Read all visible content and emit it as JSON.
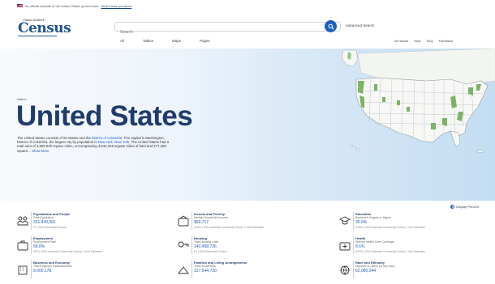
{
  "gov_banner": {
    "text": "An official website of the United States government",
    "link": "Here's how you know"
  },
  "logo": {
    "small": "United States®",
    "big": "Census"
  },
  "search": {
    "placeholder": "Search",
    "advanced": "Advanced Search"
  },
  "tabs": [
    "All",
    "Tables",
    "Maps",
    "Pages"
  ],
  "util_links": [
    "All results",
    "Help",
    "FAQ",
    "Feedback"
  ],
  "hero": {
    "breadcrumb": "Nation",
    "title": "United States",
    "desc_1": "The United States consists of 50 States and the",
    "desc_link_1": "District of Columbia",
    "desc_2": ". The capital is Washington, District of Columbia, the largest city by population is",
    "desc_link_2": "New York, New York",
    "desc_3": ". The United States had a total area of 3,809,525 square miles, encompassing 3,532,316 square miles of land and 277,209 square...",
    "desc_more": "Show More"
  },
  "display_toggle": "Display Percent",
  "cards": [
    {
      "name": "population",
      "category": "Populations and People",
      "sub": "Total Population",
      "value": "331,449,281",
      "source": "P1 | 2020 Decennial Census"
    },
    {
      "name": "income",
      "category": "Income and Poverty",
      "sub": "Median Household Income",
      "value": "$69,717",
      "source": "S1901 | 2021 American Community Survey 1-Year Estimates"
    },
    {
      "name": "education",
      "category": "Education",
      "sub": "Bachelor's Degree or Higher",
      "value": "35.0%",
      "source": "S1501 | 2021 American Community Survey 1-Year Estimates"
    },
    {
      "name": "employment",
      "category": "Employment",
      "sub": "Employment Rate",
      "value": "58.8%",
      "source": "DP03 | 2021 American Community Survey 1-Year Estimates"
    },
    {
      "name": "housing",
      "category": "Housing",
      "sub": "Total Housing Units",
      "value": "140,498,736",
      "source": "H1 | 2020 Decennial Census"
    },
    {
      "name": "health",
      "category": "Health",
      "sub": "Without Health Care Coverage",
      "value": "8.6%",
      "source": "S2701 | 2021 American Community Survey 1-Year Estimates"
    },
    {
      "name": "business",
      "category": "Business and Economy",
      "sub": "Total Employer Establishments",
      "value": "8,000,178",
      "source": ""
    },
    {
      "name": "families",
      "category": "Families and Living Arrangements",
      "sub": "Total Households",
      "value": "127,544,730",
      "source": ""
    },
    {
      "name": "race",
      "category": "Race and Ethnicity",
      "sub": "Hispanic or Latino (of any race)",
      "value": "62,080,044",
      "source": ""
    }
  ]
}
